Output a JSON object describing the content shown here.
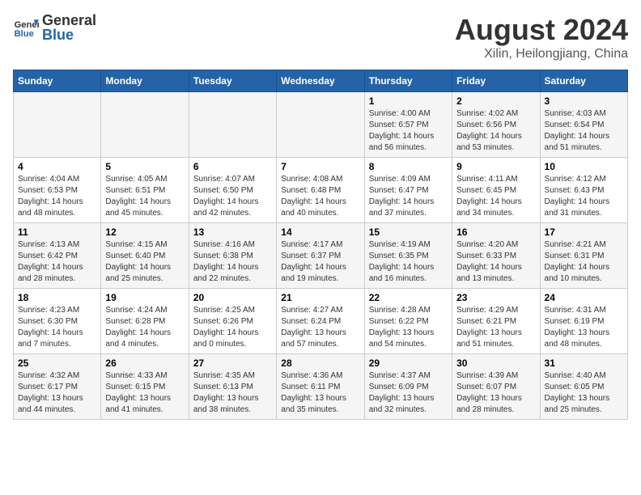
{
  "logo": {
    "general": "General",
    "blue": "Blue"
  },
  "title": "August 2024",
  "subtitle": "Xilin, Heilongjiang, China",
  "days_of_week": [
    "Sunday",
    "Monday",
    "Tuesday",
    "Wednesday",
    "Thursday",
    "Friday",
    "Saturday"
  ],
  "weeks": [
    [
      {
        "day": "",
        "info": ""
      },
      {
        "day": "",
        "info": ""
      },
      {
        "day": "",
        "info": ""
      },
      {
        "day": "",
        "info": ""
      },
      {
        "day": "1",
        "info": "Sunrise: 4:00 AM\nSunset: 6:57 PM\nDaylight: 14 hours\nand 56 minutes."
      },
      {
        "day": "2",
        "info": "Sunrise: 4:02 AM\nSunset: 6:56 PM\nDaylight: 14 hours\nand 53 minutes."
      },
      {
        "day": "3",
        "info": "Sunrise: 4:03 AM\nSunset: 6:54 PM\nDaylight: 14 hours\nand 51 minutes."
      }
    ],
    [
      {
        "day": "4",
        "info": "Sunrise: 4:04 AM\nSunset: 6:53 PM\nDaylight: 14 hours\nand 48 minutes."
      },
      {
        "day": "5",
        "info": "Sunrise: 4:05 AM\nSunset: 6:51 PM\nDaylight: 14 hours\nand 45 minutes."
      },
      {
        "day": "6",
        "info": "Sunrise: 4:07 AM\nSunset: 6:50 PM\nDaylight: 14 hours\nand 42 minutes."
      },
      {
        "day": "7",
        "info": "Sunrise: 4:08 AM\nSunset: 6:48 PM\nDaylight: 14 hours\nand 40 minutes."
      },
      {
        "day": "8",
        "info": "Sunrise: 4:09 AM\nSunset: 6:47 PM\nDaylight: 14 hours\nand 37 minutes."
      },
      {
        "day": "9",
        "info": "Sunrise: 4:11 AM\nSunset: 6:45 PM\nDaylight: 14 hours\nand 34 minutes."
      },
      {
        "day": "10",
        "info": "Sunrise: 4:12 AM\nSunset: 6:43 PM\nDaylight: 14 hours\nand 31 minutes."
      }
    ],
    [
      {
        "day": "11",
        "info": "Sunrise: 4:13 AM\nSunset: 6:42 PM\nDaylight: 14 hours\nand 28 minutes."
      },
      {
        "day": "12",
        "info": "Sunrise: 4:15 AM\nSunset: 6:40 PM\nDaylight: 14 hours\nand 25 minutes."
      },
      {
        "day": "13",
        "info": "Sunrise: 4:16 AM\nSunset: 6:38 PM\nDaylight: 14 hours\nand 22 minutes."
      },
      {
        "day": "14",
        "info": "Sunrise: 4:17 AM\nSunset: 6:37 PM\nDaylight: 14 hours\nand 19 minutes."
      },
      {
        "day": "15",
        "info": "Sunrise: 4:19 AM\nSunset: 6:35 PM\nDaylight: 14 hours\nand 16 minutes."
      },
      {
        "day": "16",
        "info": "Sunrise: 4:20 AM\nSunset: 6:33 PM\nDaylight: 14 hours\nand 13 minutes."
      },
      {
        "day": "17",
        "info": "Sunrise: 4:21 AM\nSunset: 6:31 PM\nDaylight: 14 hours\nand 10 minutes."
      }
    ],
    [
      {
        "day": "18",
        "info": "Sunrise: 4:23 AM\nSunset: 6:30 PM\nDaylight: 14 hours\nand 7 minutes."
      },
      {
        "day": "19",
        "info": "Sunrise: 4:24 AM\nSunset: 6:28 PM\nDaylight: 14 hours\nand 4 minutes."
      },
      {
        "day": "20",
        "info": "Sunrise: 4:25 AM\nSunset: 6:26 PM\nDaylight: 14 hours\nand 0 minutes."
      },
      {
        "day": "21",
        "info": "Sunrise: 4:27 AM\nSunset: 6:24 PM\nDaylight: 13 hours\nand 57 minutes."
      },
      {
        "day": "22",
        "info": "Sunrise: 4:28 AM\nSunset: 6:22 PM\nDaylight: 13 hours\nand 54 minutes."
      },
      {
        "day": "23",
        "info": "Sunrise: 4:29 AM\nSunset: 6:21 PM\nDaylight: 13 hours\nand 51 minutes."
      },
      {
        "day": "24",
        "info": "Sunrise: 4:31 AM\nSunset: 6:19 PM\nDaylight: 13 hours\nand 48 minutes."
      }
    ],
    [
      {
        "day": "25",
        "info": "Sunrise: 4:32 AM\nSunset: 6:17 PM\nDaylight: 13 hours\nand 44 minutes."
      },
      {
        "day": "26",
        "info": "Sunrise: 4:33 AM\nSunset: 6:15 PM\nDaylight: 13 hours\nand 41 minutes."
      },
      {
        "day": "27",
        "info": "Sunrise: 4:35 AM\nSunset: 6:13 PM\nDaylight: 13 hours\nand 38 minutes."
      },
      {
        "day": "28",
        "info": "Sunrise: 4:36 AM\nSunset: 6:11 PM\nDaylight: 13 hours\nand 35 minutes."
      },
      {
        "day": "29",
        "info": "Sunrise: 4:37 AM\nSunset: 6:09 PM\nDaylight: 13 hours\nand 32 minutes."
      },
      {
        "day": "30",
        "info": "Sunrise: 4:39 AM\nSunset: 6:07 PM\nDaylight: 13 hours\nand 28 minutes."
      },
      {
        "day": "31",
        "info": "Sunrise: 4:40 AM\nSunset: 6:05 PM\nDaylight: 13 hours\nand 25 minutes."
      }
    ]
  ]
}
